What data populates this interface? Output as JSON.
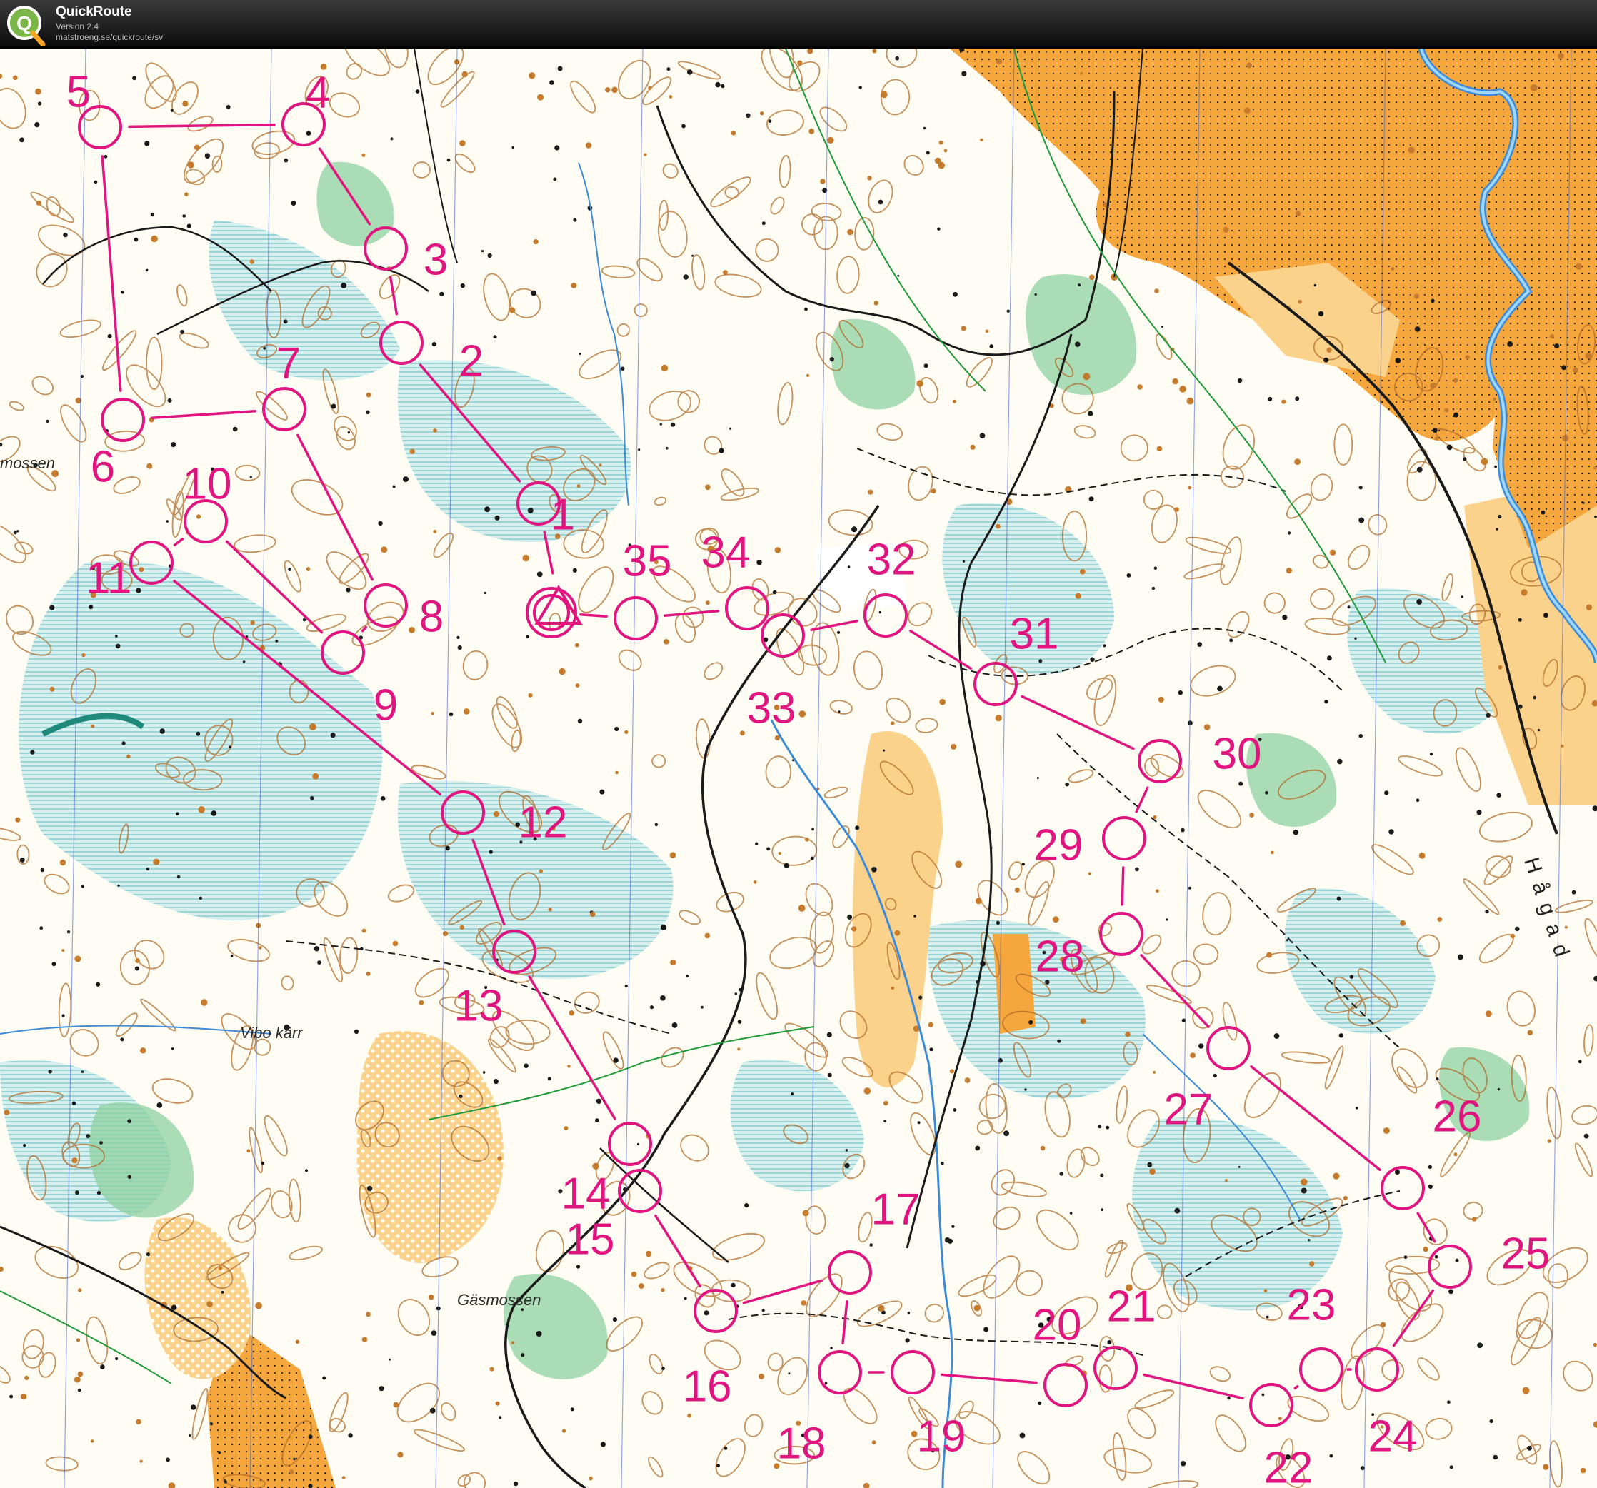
{
  "app": {
    "name": "QuickRoute",
    "version": "Version 2.4",
    "url": "matstroeng.se/quickroute/sv"
  },
  "map": {
    "place_names": {
      "mossen": "mossen",
      "vibo_karr": "Vibo kärr",
      "gasmossen": "Gäsmossen"
    },
    "road_name": "Hågad",
    "course_color": "#e0157f",
    "colors": {
      "open_land": "#f5a73d",
      "rough_open": "#fbd28c",
      "marsh": "#9fd8d6",
      "vegetation": "#8dd0a0",
      "contour": "#b06b2a",
      "water": "#3d8ad6",
      "path": "#1a1a1a"
    },
    "start_label": "start-triangle",
    "finish_label": "finish-circles"
  },
  "course": {
    "controls": [
      {
        "number": "1"
      },
      {
        "number": "2"
      },
      {
        "number": "3"
      },
      {
        "number": "4"
      },
      {
        "number": "5"
      },
      {
        "number": "6"
      },
      {
        "number": "7"
      },
      {
        "number": "8"
      },
      {
        "number": "9"
      },
      {
        "number": "10"
      },
      {
        "number": "11"
      },
      {
        "number": "12"
      },
      {
        "number": "13"
      },
      {
        "number": "14"
      },
      {
        "number": "15"
      },
      {
        "number": "16"
      },
      {
        "number": "17"
      },
      {
        "number": "18"
      },
      {
        "number": "19"
      },
      {
        "number": "20"
      },
      {
        "number": "21"
      },
      {
        "number": "22"
      },
      {
        "number": "23"
      },
      {
        "number": "24"
      },
      {
        "number": "25"
      },
      {
        "number": "26"
      },
      {
        "number": "27"
      },
      {
        "number": "28"
      },
      {
        "number": "29"
      },
      {
        "number": "30"
      },
      {
        "number": "31"
      },
      {
        "number": "32"
      },
      {
        "number": "33"
      },
      {
        "number": "34"
      },
      {
        "number": "35"
      }
    ]
  }
}
